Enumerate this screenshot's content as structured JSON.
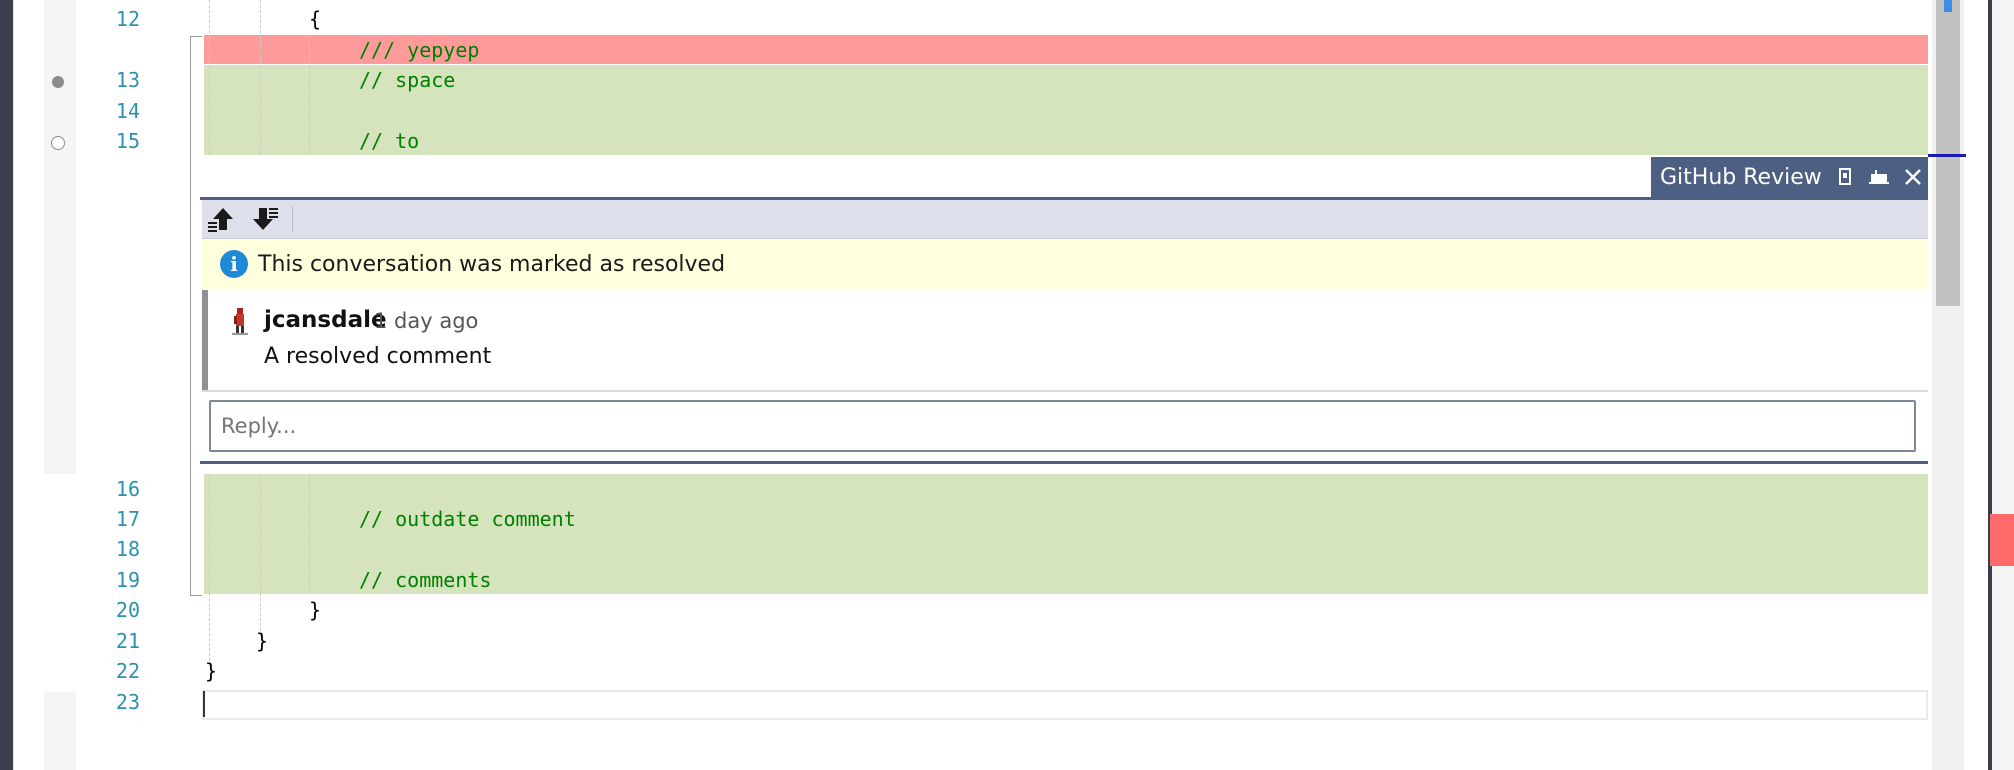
{
  "editor": {
    "lines": [
      {
        "num": "12",
        "text": "{",
        "kind": "normal"
      },
      {
        "num": "",
        "text": "/// yepyep",
        "kind": "deleted"
      },
      {
        "num": "13",
        "text": "// space",
        "kind": "added"
      },
      {
        "num": "14",
        "text": "",
        "kind": "added"
      },
      {
        "num": "15",
        "text": "// to",
        "kind": "added"
      },
      {
        "num": "16",
        "text": "",
        "kind": "added"
      },
      {
        "num": "17",
        "text": "// outdate comment",
        "kind": "added"
      },
      {
        "num": "18",
        "text": "",
        "kind": "added"
      },
      {
        "num": "19",
        "text": "// comments",
        "kind": "added"
      },
      {
        "num": "20",
        "text": "}",
        "kind": "normal"
      },
      {
        "num": "21",
        "text": "}",
        "kind": "normal"
      },
      {
        "num": "22",
        "text": "}",
        "kind": "normal"
      },
      {
        "num": "23",
        "text": "",
        "kind": "normal"
      }
    ]
  },
  "review": {
    "header_title": "GitHub Review",
    "icons": {
      "pin": "pin-icon",
      "dock": "dock-icon",
      "close": "close-icon",
      "prev": "previous-comment-icon",
      "next": "next-comment-icon",
      "info": "info-icon"
    },
    "info_message": "This conversation was marked as resolved",
    "comment": {
      "author": "jcansdale",
      "time": "1 day ago",
      "body": "A resolved comment"
    },
    "reply_placeholder": "Reply..."
  },
  "colors": {
    "deleted_bg": "#ff9a9a",
    "added_bg": "#d6e4bd",
    "line_number": "#2b91af",
    "comment_text": "#008000",
    "review_header": "#4d6083",
    "info_bg": "#ffffde"
  }
}
